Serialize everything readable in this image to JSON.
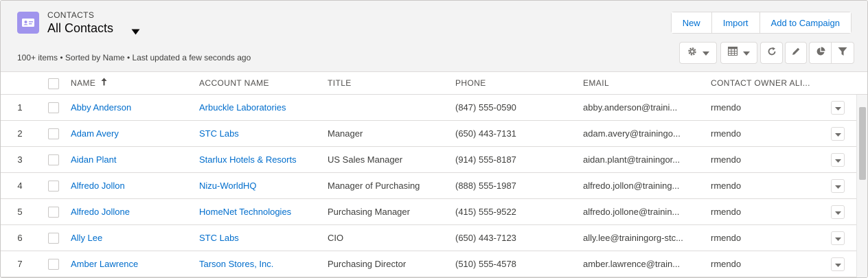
{
  "header": {
    "object_label": "CONTACTS",
    "list_title": "All Contacts",
    "meta": "100+ items • Sorted by Name • Last updated a few seconds ago",
    "icon": "contact-card-icon"
  },
  "actions": [
    {
      "label": "New"
    },
    {
      "label": "Import"
    },
    {
      "label": "Add to Campaign"
    }
  ],
  "toolbar": {
    "icons": [
      "gear-icon",
      "table-icon",
      "refresh-icon",
      "pencil-icon",
      "pie-chart-icon",
      "filter-icon"
    ]
  },
  "table": {
    "columns": [
      {
        "label": "Name",
        "sorted": "ascending"
      },
      {
        "label": "Account Name"
      },
      {
        "label": "Title"
      },
      {
        "label": "Phone"
      },
      {
        "label": "Email"
      },
      {
        "label": "Contact Owner Ali..."
      }
    ],
    "rows": [
      {
        "num": "1",
        "name": "Abby Anderson",
        "account": "Arbuckle Laboratories",
        "title": "",
        "phone": "(847) 555-0590",
        "email": "abby.anderson@traini...",
        "owner": "rmendo"
      },
      {
        "num": "2",
        "name": "Adam Avery",
        "account": "STC Labs",
        "title": "Manager",
        "phone": "(650) 443-7131",
        "email": "adam.avery@trainingo...",
        "owner": "rmendo"
      },
      {
        "num": "3",
        "name": "Aidan Plant",
        "account": "Starlux Hotels & Resorts",
        "title": "US Sales Manager",
        "phone": "(914) 555-8187",
        "email": "aidan.plant@trainingor...",
        "owner": "rmendo"
      },
      {
        "num": "4",
        "name": "Alfredo Jollon",
        "account": "Nizu-WorldHQ",
        "title": "Manager of Purchasing",
        "phone": "(888) 555-1987",
        "email": "alfredo.jollon@training...",
        "owner": "rmendo"
      },
      {
        "num": "5",
        "name": "Alfredo Jollone",
        "account": "HomeNet Technologies",
        "title": "Purchasing Manager",
        "phone": "(415) 555-9522",
        "email": "alfredo.jollone@trainin...",
        "owner": "rmendo"
      },
      {
        "num": "6",
        "name": "Ally Lee",
        "account": "STC Labs",
        "title": "CIO",
        "phone": "(650) 443-7123",
        "email": "ally.lee@trainingorg-stc...",
        "owner": "rmendo"
      },
      {
        "num": "7",
        "name": "Amber Lawrence",
        "account": "Tarson Stores, Inc.",
        "title": "Purchasing Director",
        "phone": "(510) 555-4578",
        "email": "amber.lawrence@train...",
        "owner": "rmendo"
      }
    ]
  },
  "colors": {
    "link": "#006dcc",
    "brand_button": "#0070d2",
    "object_icon": "#a094ed",
    "header_bg": "#f3f3f3"
  }
}
